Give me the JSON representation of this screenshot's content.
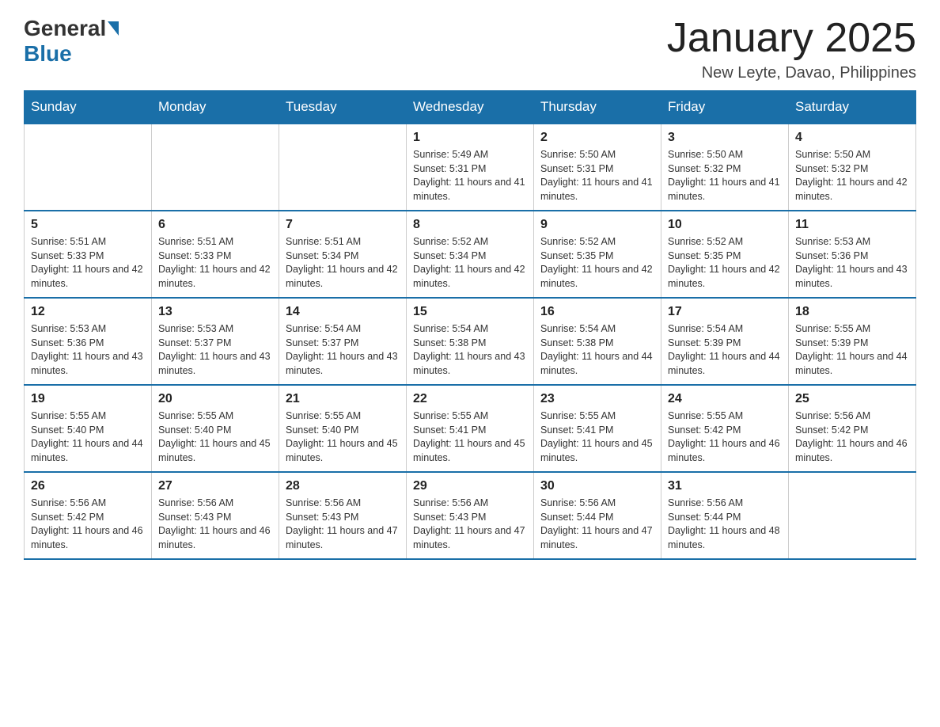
{
  "logo": {
    "general": "General",
    "blue": "Blue"
  },
  "title": "January 2025",
  "location": "New Leyte, Davao, Philippines",
  "days_header": [
    "Sunday",
    "Monday",
    "Tuesday",
    "Wednesday",
    "Thursday",
    "Friday",
    "Saturday"
  ],
  "weeks": [
    [
      {
        "day": "",
        "info": ""
      },
      {
        "day": "",
        "info": ""
      },
      {
        "day": "",
        "info": ""
      },
      {
        "day": "1",
        "info": "Sunrise: 5:49 AM\nSunset: 5:31 PM\nDaylight: 11 hours and 41 minutes."
      },
      {
        "day": "2",
        "info": "Sunrise: 5:50 AM\nSunset: 5:31 PM\nDaylight: 11 hours and 41 minutes."
      },
      {
        "day": "3",
        "info": "Sunrise: 5:50 AM\nSunset: 5:32 PM\nDaylight: 11 hours and 41 minutes."
      },
      {
        "day": "4",
        "info": "Sunrise: 5:50 AM\nSunset: 5:32 PM\nDaylight: 11 hours and 42 minutes."
      }
    ],
    [
      {
        "day": "5",
        "info": "Sunrise: 5:51 AM\nSunset: 5:33 PM\nDaylight: 11 hours and 42 minutes."
      },
      {
        "day": "6",
        "info": "Sunrise: 5:51 AM\nSunset: 5:33 PM\nDaylight: 11 hours and 42 minutes."
      },
      {
        "day": "7",
        "info": "Sunrise: 5:51 AM\nSunset: 5:34 PM\nDaylight: 11 hours and 42 minutes."
      },
      {
        "day": "8",
        "info": "Sunrise: 5:52 AM\nSunset: 5:34 PM\nDaylight: 11 hours and 42 minutes."
      },
      {
        "day": "9",
        "info": "Sunrise: 5:52 AM\nSunset: 5:35 PM\nDaylight: 11 hours and 42 minutes."
      },
      {
        "day": "10",
        "info": "Sunrise: 5:52 AM\nSunset: 5:35 PM\nDaylight: 11 hours and 42 minutes."
      },
      {
        "day": "11",
        "info": "Sunrise: 5:53 AM\nSunset: 5:36 PM\nDaylight: 11 hours and 43 minutes."
      }
    ],
    [
      {
        "day": "12",
        "info": "Sunrise: 5:53 AM\nSunset: 5:36 PM\nDaylight: 11 hours and 43 minutes."
      },
      {
        "day": "13",
        "info": "Sunrise: 5:53 AM\nSunset: 5:37 PM\nDaylight: 11 hours and 43 minutes."
      },
      {
        "day": "14",
        "info": "Sunrise: 5:54 AM\nSunset: 5:37 PM\nDaylight: 11 hours and 43 minutes."
      },
      {
        "day": "15",
        "info": "Sunrise: 5:54 AM\nSunset: 5:38 PM\nDaylight: 11 hours and 43 minutes."
      },
      {
        "day": "16",
        "info": "Sunrise: 5:54 AM\nSunset: 5:38 PM\nDaylight: 11 hours and 44 minutes."
      },
      {
        "day": "17",
        "info": "Sunrise: 5:54 AM\nSunset: 5:39 PM\nDaylight: 11 hours and 44 minutes."
      },
      {
        "day": "18",
        "info": "Sunrise: 5:55 AM\nSunset: 5:39 PM\nDaylight: 11 hours and 44 minutes."
      }
    ],
    [
      {
        "day": "19",
        "info": "Sunrise: 5:55 AM\nSunset: 5:40 PM\nDaylight: 11 hours and 44 minutes."
      },
      {
        "day": "20",
        "info": "Sunrise: 5:55 AM\nSunset: 5:40 PM\nDaylight: 11 hours and 45 minutes."
      },
      {
        "day": "21",
        "info": "Sunrise: 5:55 AM\nSunset: 5:40 PM\nDaylight: 11 hours and 45 minutes."
      },
      {
        "day": "22",
        "info": "Sunrise: 5:55 AM\nSunset: 5:41 PM\nDaylight: 11 hours and 45 minutes."
      },
      {
        "day": "23",
        "info": "Sunrise: 5:55 AM\nSunset: 5:41 PM\nDaylight: 11 hours and 45 minutes."
      },
      {
        "day": "24",
        "info": "Sunrise: 5:55 AM\nSunset: 5:42 PM\nDaylight: 11 hours and 46 minutes."
      },
      {
        "day": "25",
        "info": "Sunrise: 5:56 AM\nSunset: 5:42 PM\nDaylight: 11 hours and 46 minutes."
      }
    ],
    [
      {
        "day": "26",
        "info": "Sunrise: 5:56 AM\nSunset: 5:42 PM\nDaylight: 11 hours and 46 minutes."
      },
      {
        "day": "27",
        "info": "Sunrise: 5:56 AM\nSunset: 5:43 PM\nDaylight: 11 hours and 46 minutes."
      },
      {
        "day": "28",
        "info": "Sunrise: 5:56 AM\nSunset: 5:43 PM\nDaylight: 11 hours and 47 minutes."
      },
      {
        "day": "29",
        "info": "Sunrise: 5:56 AM\nSunset: 5:43 PM\nDaylight: 11 hours and 47 minutes."
      },
      {
        "day": "30",
        "info": "Sunrise: 5:56 AM\nSunset: 5:44 PM\nDaylight: 11 hours and 47 minutes."
      },
      {
        "day": "31",
        "info": "Sunrise: 5:56 AM\nSunset: 5:44 PM\nDaylight: 11 hours and 48 minutes."
      },
      {
        "day": "",
        "info": ""
      }
    ]
  ]
}
